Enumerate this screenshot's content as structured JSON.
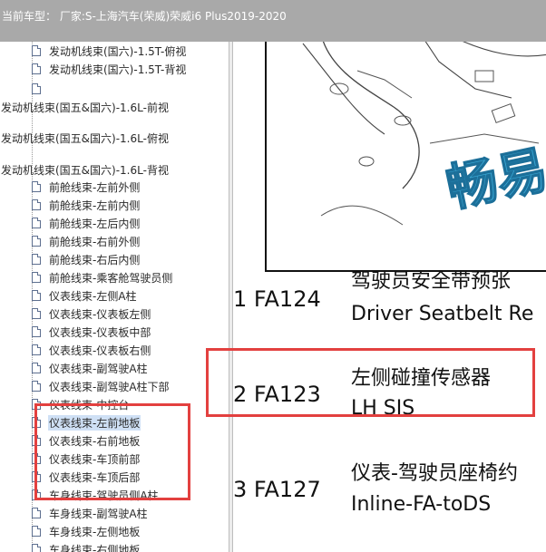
{
  "header": {
    "title": "当前车型： 厂家:S-上海汽车(荣威)荣威i6 Plus2019-2020"
  },
  "tree": {
    "selected_index": 18,
    "items": [
      {
        "label": "发动机线束(国六)-1.5T-俯视",
        "icon": "document-icon",
        "level": "child"
      },
      {
        "label": "发动机线束(国六)-1.5T-背视",
        "icon": "document-icon",
        "level": "child"
      },
      {
        "label": "",
        "icon": "document-icon",
        "level": "child"
      },
      {
        "label": "发动机线束(国五&国六)-1.6L-前视",
        "icon": "",
        "level": "root"
      },
      {
        "label": "发动机线束(国五&国六)-1.6L-俯视",
        "icon": "",
        "level": "root"
      },
      {
        "label": "发动机线束(国五&国六)-1.6L-背视",
        "icon": "",
        "level": "root"
      },
      {
        "label": "前舱线束-左前外侧",
        "icon": "document-icon",
        "level": "child"
      },
      {
        "label": "前舱线束-左前内侧",
        "icon": "document-icon",
        "level": "child"
      },
      {
        "label": "前舱线束-左后内侧",
        "icon": "document-icon",
        "level": "child"
      },
      {
        "label": "前舱线束-右前外侧",
        "icon": "document-icon",
        "level": "child"
      },
      {
        "label": "前舱线束-右后内侧",
        "icon": "document-icon",
        "level": "child"
      },
      {
        "label": "前舱线束-乘客舱驾驶员侧",
        "icon": "document-icon",
        "level": "child"
      },
      {
        "label": "仪表线束-左侧A柱",
        "icon": "document-icon",
        "level": "child"
      },
      {
        "label": "仪表线束-仪表板左侧",
        "icon": "document-icon",
        "level": "child"
      },
      {
        "label": "仪表线束-仪表板中部",
        "icon": "document-icon",
        "level": "child"
      },
      {
        "label": "仪表线束-仪表板右侧",
        "icon": "document-icon",
        "level": "child"
      },
      {
        "label": "仪表线束-副驾驶A柱",
        "icon": "document-icon",
        "level": "child"
      },
      {
        "label": "仪表线束-副驾驶A柱下部",
        "icon": "document-icon",
        "level": "child"
      },
      {
        "label": "仪表线束-中控台",
        "icon": "document-icon",
        "level": "child"
      },
      {
        "label": "仪表线束-左前地板",
        "icon": "document-icon",
        "level": "child"
      },
      {
        "label": "仪表线束-右前地板",
        "icon": "document-icon",
        "level": "child"
      },
      {
        "label": "仪表线束-车顶前部",
        "icon": "document-icon",
        "level": "child"
      },
      {
        "label": "仪表线束-车顶后部",
        "icon": "document-icon",
        "level": "child"
      },
      {
        "label": "车身线束-驾驶员侧A柱",
        "icon": "document-icon",
        "level": "child"
      },
      {
        "label": "车身线束-副驾驶A柱",
        "icon": "document-icon",
        "level": "child"
      },
      {
        "label": "车身线束-左侧地板",
        "icon": "document-icon",
        "level": "child"
      },
      {
        "label": "车身线束-右侧地板",
        "icon": "document-icon",
        "level": "child"
      }
    ]
  },
  "content": {
    "watermark": "畅易",
    "entries": [
      {
        "num": "1 FA124",
        "cn": "驾驶员安全带预张",
        "en": "Driver Seatbelt Re"
      },
      {
        "num": "2 FA123",
        "cn": "左侧碰撞传感器",
        "en": "LH SIS"
      },
      {
        "num": "3 FA127",
        "cn": "仪表-驾驶员座椅约",
        "en": "Inline-FA-toDS"
      }
    ]
  },
  "colors": {
    "header_bg": "#a9a9a9",
    "highlight_red": "#e3403f",
    "selection_bg": "#cfe0f5",
    "watermark_blue": "#3aa9d6"
  }
}
